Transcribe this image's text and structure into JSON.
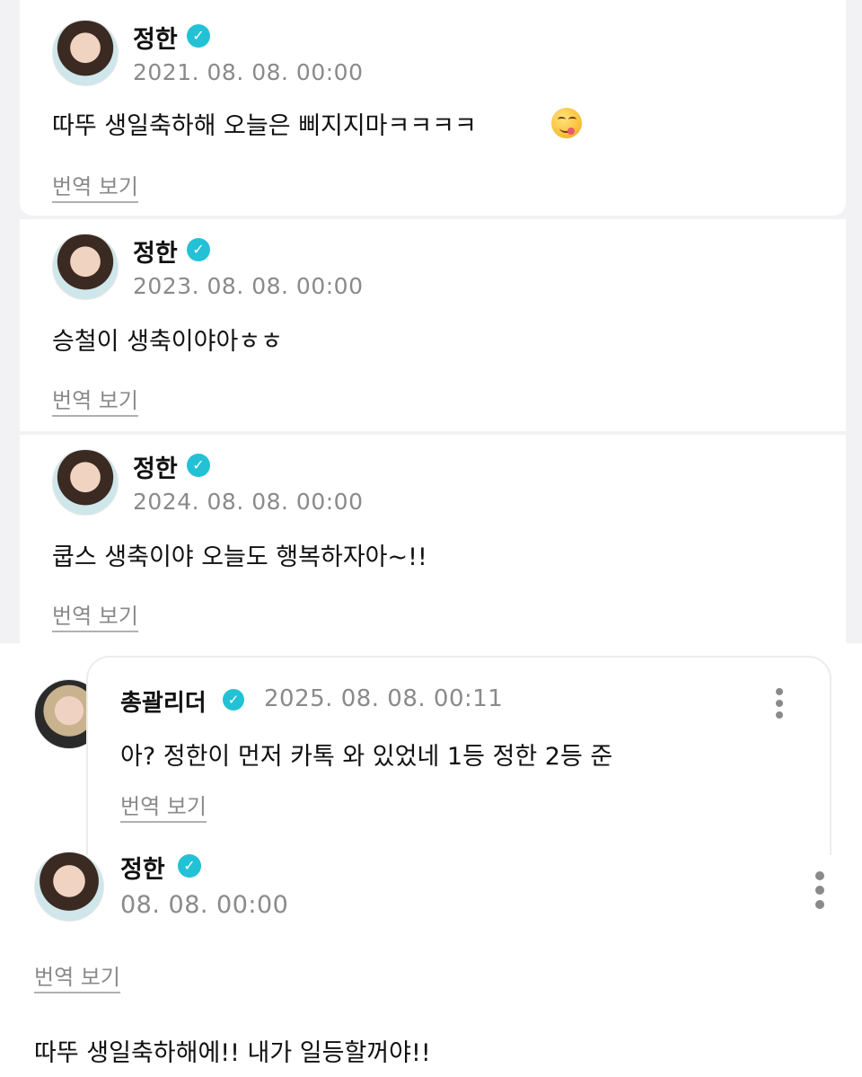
{
  "posts": [
    {
      "author": "정한",
      "date": "2021. 08. 08. 00:00",
      "message": "따뚜 생일축하해 오늘은 삐지지마ㅋㅋㅋㅋ",
      "emoji": "yum-face-emoji",
      "translate_label": "번역 보기"
    },
    {
      "author": "정한",
      "date": "2023. 08. 08. 00:00",
      "message": "승철이 생축이야아ㅎㅎ",
      "translate_label": "번역 보기"
    },
    {
      "author": "정한",
      "date": "2024. 08. 08. 00:00",
      "message": "쿱스 생축이야 오늘도 행복하자아~!!",
      "translate_label": "번역 보기"
    }
  ],
  "reply": {
    "author": "총괄리더",
    "date": "2025. 08. 08. 00:11",
    "message": "아? 정한이 먼저 카톡 와 있었네 1등 정한 2등 준",
    "translate_label": "번역 보기"
  },
  "latest": {
    "author": "정한",
    "date": "08. 08. 00:00",
    "translate_label": "번역 보기",
    "message": "따뚜 생일축하해에!! 내가 일등할꺼야!!"
  },
  "icons": {
    "verified": "verified-badge-icon",
    "more": "more-vertical-icon"
  },
  "colors": {
    "verified": "#23c1d6",
    "muted_text": "#8a8a8a",
    "background": "#f2f2f4"
  }
}
